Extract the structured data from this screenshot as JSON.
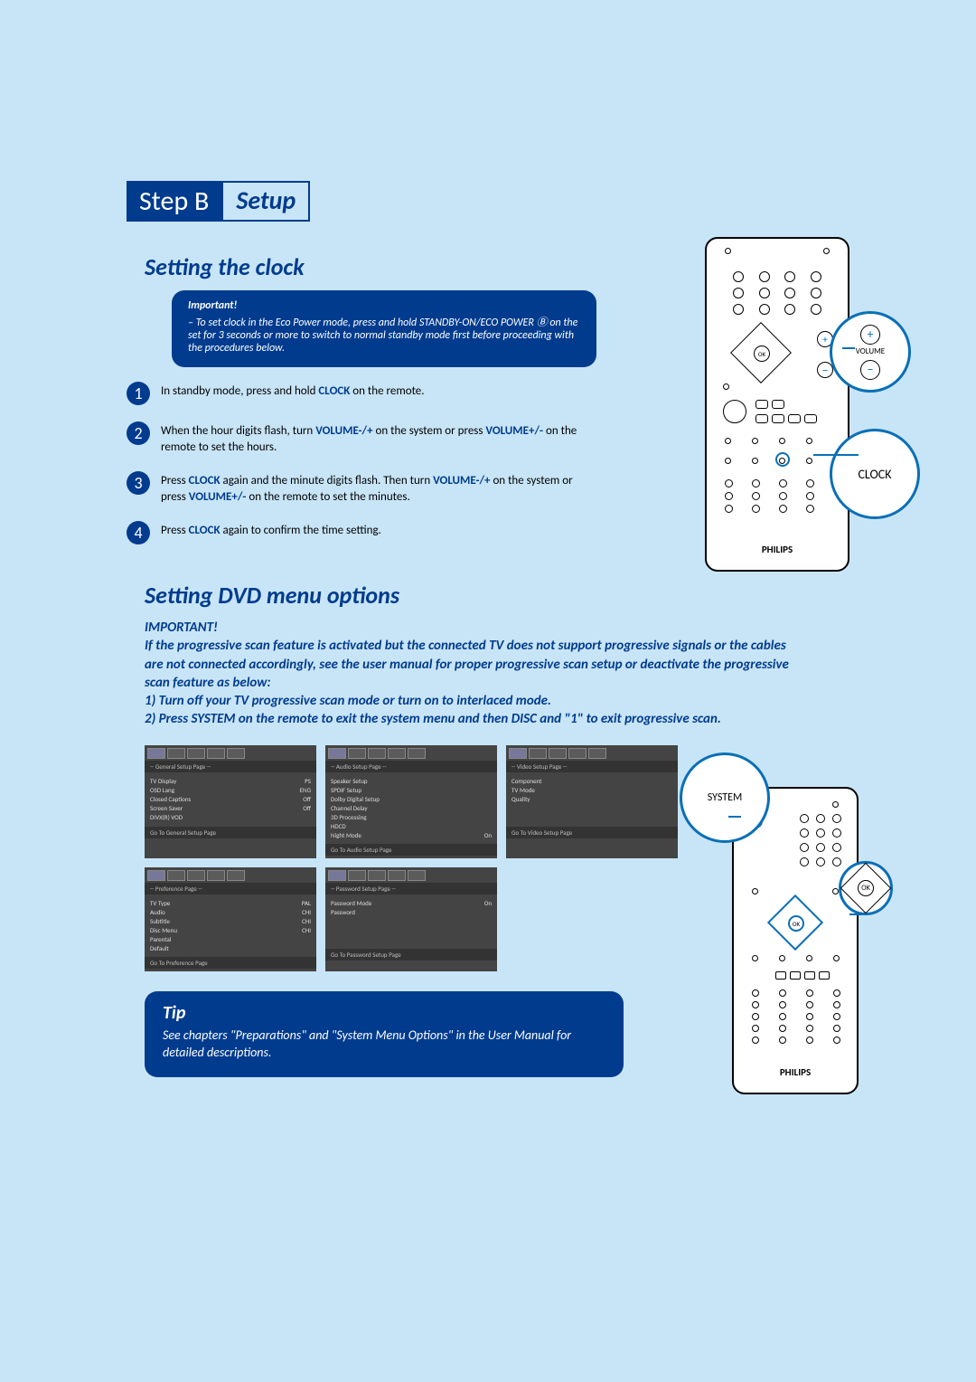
{
  "header": {
    "step_badge": "Step B",
    "step_label": "Setup"
  },
  "section1": {
    "title": "Setting the clock",
    "important": {
      "head": "Important!",
      "body": "– To set clock in the Eco Power mode, press and hold STANDBY-ON/ECO POWER Ⓑ on the set for 3 seconds or more to switch to normal standby mode first before proceeding with the procedures below."
    },
    "steps": [
      {
        "n": "1",
        "pre": "In standby mode, press and hold ",
        "hl": "CLOCK",
        "post": " on the remote."
      },
      {
        "n": "2",
        "pre": "When the hour digits flash, turn ",
        "hl": "VOLUME-/+",
        "mid": " on the system or press ",
        "hl2": "VOLUME+/-",
        "post": " on the remote to set the hours."
      },
      {
        "n": "3",
        "pre": "Press ",
        "hl": "CLOCK",
        "mid": " again and the minute digits flash. Then turn ",
        "hl2": "VOLUME-/+",
        "mid2": " on the system or press ",
        "hl3": "VOLUME+/-",
        "post": " on the remote to set the minutes."
      },
      {
        "n": "4",
        "pre": "Press ",
        "hl": "CLOCK",
        "post": " again to confirm the time setting."
      }
    ]
  },
  "remote1": {
    "brand": "PHILIPS",
    "callout_clock": "CLOCK",
    "callout_volume": "VOLUME",
    "ok_label": "OK"
  },
  "section2": {
    "title": "Setting DVD menu options",
    "important_head": "IMPORTANT!",
    "important_body": "If the progressive scan feature is activated but the connected TV does not support progressive signals or the cables are not connected accordingly, see the user manual for proper progressive scan setup or deactivate the progressive scan feature as below:\n1) Turn off your TV progressive scan mode or turn on to interlaced mode.\n2) Press SYSTEM on the remote to exit the system menu and then DISC and \"1\" to exit progressive scan."
  },
  "screens": [
    {
      "title": "-- General Setup Page --",
      "rows": [
        [
          "TV Display",
          "PS"
        ],
        [
          "OSD Lang",
          "ENG"
        ],
        [
          "Closed Captions",
          "Off"
        ],
        [
          "Screen Saver",
          "Off"
        ],
        [
          "DIVX(R) VOD",
          ""
        ]
      ],
      "footer": "Go To General Setup Page"
    },
    {
      "title": "-- Audio Setup Page --",
      "rows": [
        [
          "Speaker Setup",
          ""
        ],
        [
          "SPDIF Setup",
          ""
        ],
        [
          "Dolby Digital Setup",
          ""
        ],
        [
          "Channel Delay",
          ""
        ],
        [
          "3D Processing",
          ""
        ],
        [
          "HDCD",
          ""
        ],
        [
          "Night Mode",
          "On"
        ]
      ],
      "footer": "Go To Audio Setup Page"
    },
    {
      "title": "-- Video Setup Page --",
      "rows": [
        [
          "Component",
          ""
        ],
        [
          "TV Mode",
          ""
        ],
        [
          "Quality",
          ""
        ]
      ],
      "footer": "Go To Video Setup Page"
    },
    {
      "title": "-- Preference Page --",
      "rows": [
        [
          "TV Type",
          "PAL"
        ],
        [
          "Audio",
          "CHI"
        ],
        [
          "Subtitle",
          "CHI"
        ],
        [
          "Disc Menu",
          "CHI"
        ],
        [
          "Parental",
          ""
        ],
        [
          "Default",
          ""
        ]
      ],
      "footer": "Go To Preference Page"
    },
    {
      "title": "-- Password Setup Page --",
      "rows": [
        [
          "Password Mode",
          "On"
        ],
        [
          "Password",
          ""
        ]
      ],
      "footer": "Go To Password Setup Page"
    }
  ],
  "remote2": {
    "brand": "PHILIPS",
    "callout_system": "SYSTEM",
    "callout_ok": "OK"
  },
  "tip": {
    "head": "Tip",
    "body": "See chapters \"Preparations\" and \"System Menu Options\" in the User Manual for detailed descriptions."
  }
}
